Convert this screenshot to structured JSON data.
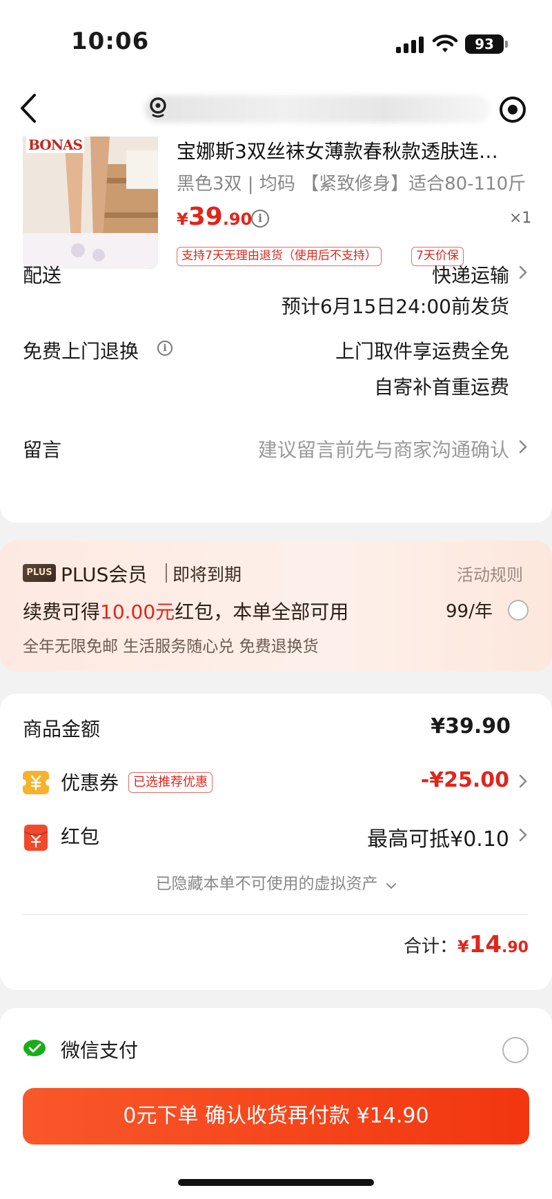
{
  "status_bar": {
    "time": "10:06",
    "battery": "93"
  },
  "product": {
    "brand": "BONAS",
    "title": "宝娜斯3双丝袜女薄款春秋款透肤连…",
    "spec": "黑色3双 | 均码 【紧致修身】适合80-110斤",
    "price_currency": "¥",
    "price_int": "39",
    "price_dec": ".90",
    "qty": "×1",
    "tags": [
      "支持7天无理由退货（使用后不支持）",
      "7天价保"
    ]
  },
  "delivery": {
    "label": "配送",
    "method": "快递运输",
    "eta": "预计6月15日24:00前发货"
  },
  "free_return": {
    "label": "免费上门退换",
    "line1": "上门取件享运费全免",
    "line2": "自寄补首重运费"
  },
  "message": {
    "label": "留言",
    "placeholder": "建议留言前先与商家沟通确认"
  },
  "plus": {
    "badge": "PLUS",
    "title": "PLUS会员",
    "expire": "即将到期",
    "rules": "活动规则",
    "main_prefix": "续费可得",
    "main_amount": "10.00元",
    "main_suffix": "红包，本单全部可用",
    "price": "99/年",
    "benefits": "全年无限免邮 生活服务随心兑 免费退换货"
  },
  "summary": {
    "goods_label": "商品金额",
    "goods_value": "¥39.90",
    "coupon_label": "优惠券",
    "coupon_tag": "已选推荐优惠",
    "coupon_value": "-¥25.00",
    "redpacket_label": "红包",
    "redpacket_value": "最高可抵¥0.10",
    "hidden_note": "已隐藏本单不可使用的虚拟资产",
    "total_label": "合计：",
    "total_currency": "¥",
    "total_int": "14",
    "total_dec": ".90"
  },
  "payment": {
    "label": "微信支付"
  },
  "submit": {
    "label": "0元下单 确认收货再付款 ¥14.90"
  },
  "colors": {
    "accent": "#e1251b",
    "button": "#f4431b",
    "plus_bg": "#fdece4"
  }
}
